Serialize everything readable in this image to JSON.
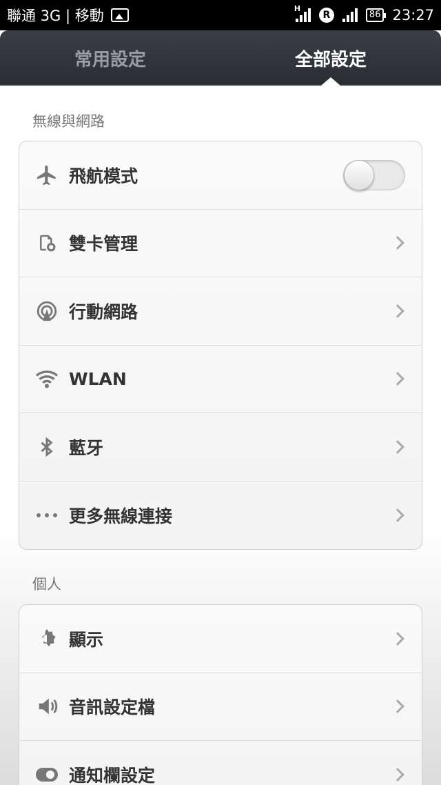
{
  "status_bar": {
    "carrier": "聯通 3G | 移動",
    "signal1_label": "H",
    "roaming_badge": "R",
    "battery_level": "86",
    "time": "23:27"
  },
  "tabs": [
    {
      "label": "常用設定",
      "active": false
    },
    {
      "label": "全部設定",
      "active": true
    }
  ],
  "sections": [
    {
      "title": "無線與網路",
      "items": [
        {
          "label": "飛航模式",
          "icon": "airplane-icon",
          "control": "toggle",
          "on": false
        },
        {
          "label": "雙卡管理",
          "icon": "sim-card-icon",
          "control": "chevron"
        },
        {
          "label": "行動網路",
          "icon": "mobile-network-icon",
          "control": "chevron"
        },
        {
          "label": "WLAN",
          "icon": "wifi-icon",
          "control": "chevron"
        },
        {
          "label": "藍牙",
          "icon": "bluetooth-icon",
          "control": "chevron"
        },
        {
          "label": "更多無線連接",
          "icon": "more-dots-icon",
          "control": "chevron"
        }
      ]
    },
    {
      "title": "個人",
      "items": [
        {
          "label": "顯示",
          "icon": "display-gear-icon",
          "control": "chevron"
        },
        {
          "label": "音訊設定檔",
          "icon": "sound-profile-icon",
          "control": "chevron"
        },
        {
          "label": "通知欄設定",
          "icon": "notification-toggle-icon",
          "control": "chevron"
        }
      ]
    }
  ],
  "colors": {
    "tab_bar": "#2f3236",
    "icon_gray": "#777777",
    "chevron_gray": "#aaaaaa"
  }
}
